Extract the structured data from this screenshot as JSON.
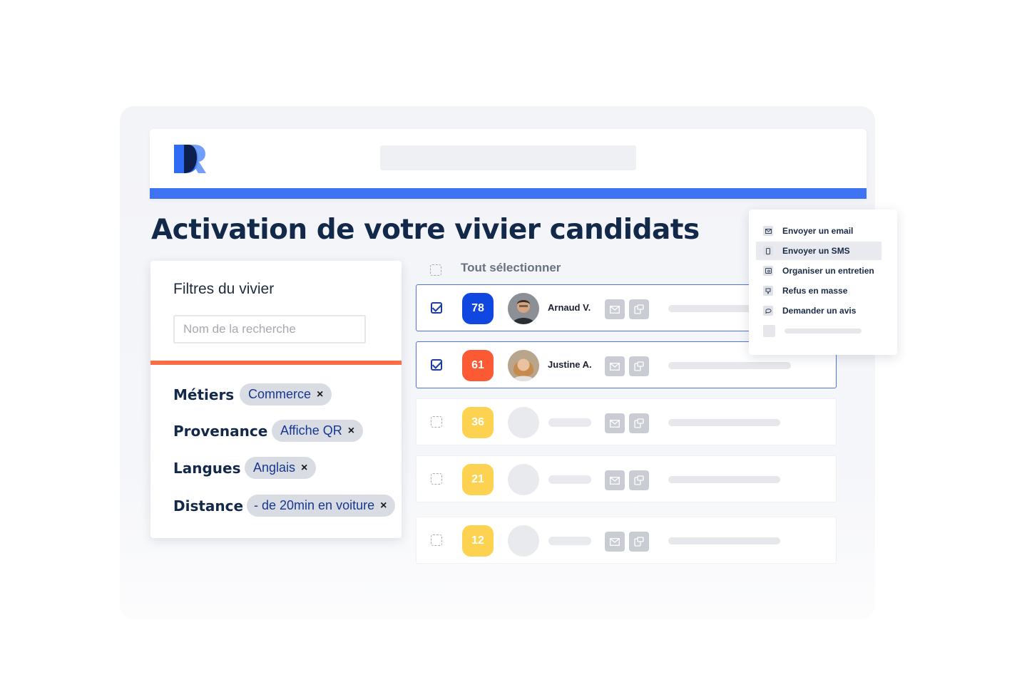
{
  "brand": {
    "color": "#3e74f4",
    "logo_icon": "rh-logo-icon"
  },
  "page": {
    "title": "Activation de votre vivier candidats"
  },
  "filters": {
    "title": "Filtres du vivier",
    "search_placeholder": "Nom de la recherche",
    "rows": [
      {
        "label": "Métiers",
        "chip": "Commerce"
      },
      {
        "label": "Provenance",
        "chip": "Affiche QR"
      },
      {
        "label": "Langues",
        "chip": "Anglais"
      },
      {
        "label": "Distance",
        "chip": "- de 20min en voiture"
      }
    ],
    "chip_remove_glyph": "×"
  },
  "list": {
    "select_all_label": "Tout sélectionner",
    "candidates": [
      {
        "score": "78",
        "name": "Arnaud V.",
        "checked": true,
        "score_color": "#1047e0"
      },
      {
        "score": "61",
        "name": "Justine A.",
        "checked": true,
        "score_color": "#fb5a35"
      },
      {
        "score": "36",
        "name": "",
        "checked": false,
        "score_color": "#fdd250"
      },
      {
        "score": "21",
        "name": "",
        "checked": false,
        "score_color": "#fdd250"
      },
      {
        "score": "12",
        "name": "",
        "checked": false,
        "score_color": "#fdd250"
      }
    ]
  },
  "actions_menu": {
    "items": [
      {
        "label": "Envoyer un email",
        "icon": "mail-icon"
      },
      {
        "label": "Envoyer un SMS",
        "icon": "phone-icon"
      },
      {
        "label": "Organiser un entretien",
        "icon": "interview-icon"
      },
      {
        "label": "Refus en masse",
        "icon": "thumbs-down-icon"
      },
      {
        "label": "Demander un avis",
        "icon": "chat-bubble-icon"
      }
    ]
  }
}
